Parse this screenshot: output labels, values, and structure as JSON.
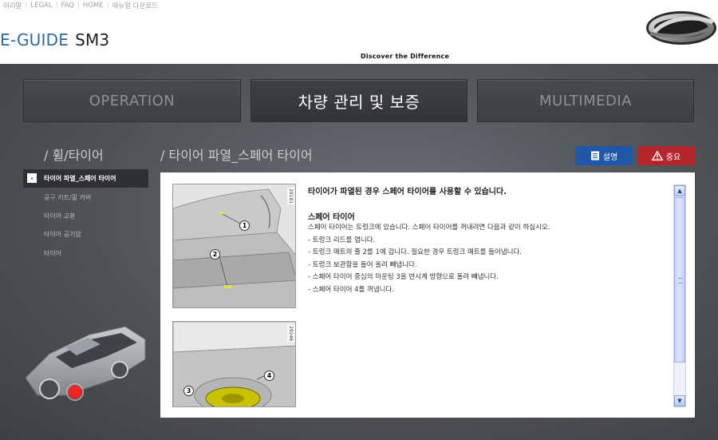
{
  "topnav": {
    "links": [
      "머리말",
      "LEGAL",
      "FAQ",
      "HOME",
      "매뉴얼 다운로드"
    ]
  },
  "brand": {
    "eguide": "E-GUIDE",
    "model": "SM3",
    "tagline": "Discover the Difference"
  },
  "tabs": [
    {
      "label": "OPERATION",
      "active": false
    },
    {
      "label": "차량 관리 및 보증",
      "active": true
    },
    {
      "label": "MULTIMEDIA",
      "active": false
    }
  ],
  "section_title": "/ 휠/타이어",
  "page_title": "/ 타이어 파열_스페어 타이어",
  "badges": {
    "explain": "설명",
    "important": "중요"
  },
  "sidebar": {
    "items": [
      {
        "label": "타이어 파열_스페어 타이어",
        "active": true
      },
      {
        "label": "공구 키트/휠 커버",
        "active": false
      },
      {
        "label": "타이어 교환",
        "active": false
      },
      {
        "label": "타이어 공기압",
        "active": false
      },
      {
        "label": "타이어",
        "active": false
      }
    ]
  },
  "content": {
    "lead": "타이어가 파열된 경우 스페어 타이어를 사용할 수 있습니다.",
    "subhead": "스페어 타이어",
    "lines": [
      "스페어 타이어는 트렁크에 있습니다. 스페어 타이어를 꺼내려면 다음과 같이 하십시오.",
      "- 트렁크 리드를 엽니다.",
      "- 트렁크 매트의 줄 2를 1에 겁니다. 필요한 경우 트렁크 매트를 들어냅니다.",
      "- 트렁크 보관함을 들어 올려 빼냅니다.",
      "- 스페어 타이어 중심의 마운팅 3을 반시계 방향으로 돌려 빼냅니다.",
      "- 스페어 타이어 4를 꺼냅니다."
    ],
    "image1": {
      "code": "29181",
      "callouts": [
        "1",
        "2"
      ]
    },
    "image2": {
      "code": "29246",
      "callouts": [
        "3",
        "4"
      ]
    }
  },
  "colors": {
    "brand_blue": "#2d6aa6",
    "explain_blue": "#1f58a8",
    "important_red": "#b3262c",
    "dark_bg": "#53565a"
  },
  "icons": {
    "explain": "document-icon",
    "important": "warning-triangle-icon",
    "back": "chevron-left-icon",
    "scroll_up": "chevron-up-icon",
    "scroll_down": "chevron-down-icon"
  }
}
